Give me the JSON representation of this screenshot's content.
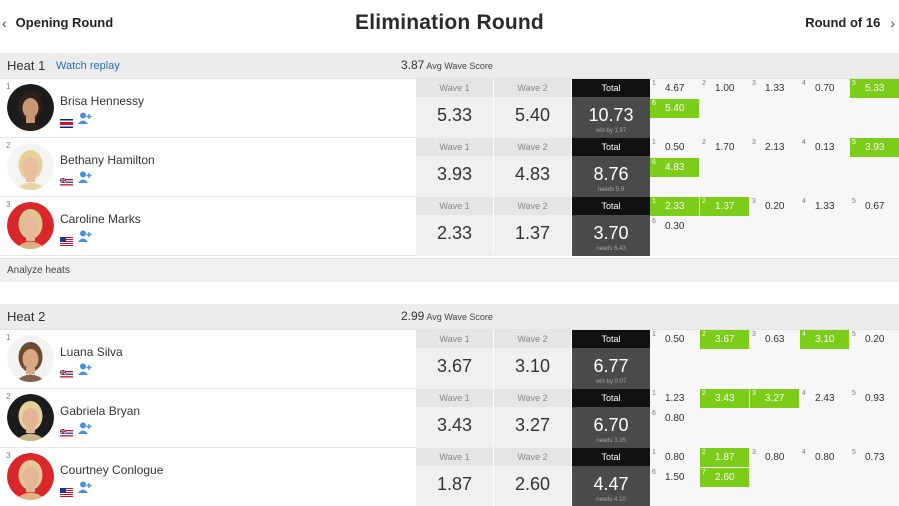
{
  "nav": {
    "prev_label": "Opening Round",
    "next_label": "Round of 16",
    "title": "Elimination Round"
  },
  "labels": {
    "wave1": "Wave 1",
    "wave2": "Wave 2",
    "total": "Total",
    "avg_label": "Avg Wave Score",
    "watch_replay": "Watch replay",
    "analyze": "Analyze heats"
  },
  "colors": {
    "highlight": "#7ccc1a",
    "total_bg": "#4a4a4a",
    "total_header": "#111111",
    "link": "#2a6fb0"
  },
  "heats": [
    {
      "title": "Heat 1",
      "avg": "3.87",
      "surfers": [
        {
          "seed": "1",
          "name": "Brisa Hennessy",
          "flag": "costa-rica-flag",
          "avatar_bg": "#1b1b1b",
          "hair": "#2e211a",
          "skin": "#c99772",
          "ring": "#111111",
          "wave1": "5.33",
          "wave2": "5.40",
          "total": "10.73",
          "note": "win by 1.97",
          "waves": [
            {
              "n": "1",
              "s": "4.67",
              "hl": false
            },
            {
              "n": "2",
              "s": "1.00",
              "hl": false
            },
            {
              "n": "3",
              "s": "1.33",
              "hl": false
            },
            {
              "n": "4",
              "s": "0.70",
              "hl": false
            },
            {
              "n": "5",
              "s": "5.33",
              "hl": true
            },
            {
              "n": "6",
              "s": "5.40",
              "hl": true
            }
          ]
        },
        {
          "seed": "2",
          "name": "Bethany Hamilton",
          "flag": "hawaii-flag",
          "avatar_bg": "#f4f4f4",
          "hair": "#e6cf98",
          "skin": "#e8bda0",
          "ring": "#ffffff",
          "wave1": "3.93",
          "wave2": "4.83",
          "total": "8.76",
          "note": "needs 5.9",
          "waves": [
            {
              "n": "1",
              "s": "0.50",
              "hl": false
            },
            {
              "n": "2",
              "s": "1.70",
              "hl": false
            },
            {
              "n": "3",
              "s": "2.13",
              "hl": false
            },
            {
              "n": "4",
              "s": "0.13",
              "hl": false
            },
            {
              "n": "5",
              "s": "3.93",
              "hl": true
            },
            {
              "n": "6",
              "s": "4.83",
              "hl": true
            }
          ]
        },
        {
          "seed": "3",
          "name": "Caroline Marks",
          "flag": "usa-flag",
          "avatar_bg": "#d8282c",
          "hair": "#e0c48e",
          "skin": "#e7b99b",
          "ring": "#d8282c",
          "wave1": "2.33",
          "wave2": "1.37",
          "total": "3.70",
          "note": "needs 6.43",
          "waves": [
            {
              "n": "1",
              "s": "2.33",
              "hl": true
            },
            {
              "n": "2",
              "s": "1.37",
              "hl": true
            },
            {
              "n": "3",
              "s": "0.20",
              "hl": false
            },
            {
              "n": "4",
              "s": "1.33",
              "hl": false
            },
            {
              "n": "5",
              "s": "0.67",
              "hl": false
            },
            {
              "n": "6",
              "s": "0.30",
              "hl": false
            }
          ]
        }
      ]
    },
    {
      "title": "Heat 2",
      "avg": "2.99",
      "surfers": [
        {
          "seed": "1",
          "name": "Luana Silva",
          "flag": "hawaii-flag",
          "avatar_bg": "#f2f2f2",
          "hair": "#6b4a30",
          "skin": "#d7a884",
          "ring": "#ffffff",
          "wave1": "3.67",
          "wave2": "3.10",
          "total": "6.77",
          "note": "win by 0.07",
          "waves": [
            {
              "n": "1",
              "s": "0.50",
              "hl": false
            },
            {
              "n": "2",
              "s": "3.67",
              "hl": true
            },
            {
              "n": "3",
              "s": "0.63",
              "hl": false
            },
            {
              "n": "4",
              "s": "3.10",
              "hl": true
            },
            {
              "n": "5",
              "s": "0.20",
              "hl": false
            }
          ]
        },
        {
          "seed": "2",
          "name": "Gabriela Bryan",
          "flag": "hawaii-flag",
          "avatar_bg": "#1b1b1b",
          "hair": "#e6cf98",
          "skin": "#e2b394",
          "ring": "#111111",
          "wave1": "3.43",
          "wave2": "3.27",
          "total": "6.70",
          "note": "needs 3.35",
          "waves": [
            {
              "n": "1",
              "s": "1.23",
              "hl": false
            },
            {
              "n": "2",
              "s": "3.43",
              "hl": true
            },
            {
              "n": "3",
              "s": "3.27",
              "hl": true
            },
            {
              "n": "4",
              "s": "2.43",
              "hl": false
            },
            {
              "n": "5",
              "s": "0.93",
              "hl": false
            },
            {
              "n": "6",
              "s": "0.80",
              "hl": false
            }
          ]
        },
        {
          "seed": "3",
          "name": "Courtney Conlogue",
          "flag": "usa-flag",
          "avatar_bg": "#d8282c",
          "hair": "#e3c890",
          "skin": "#e4b597",
          "ring": "#d8282c",
          "wave1": "1.87",
          "wave2": "2.60",
          "total": "4.47",
          "note": "needs 4.10",
          "waves": [
            {
              "n": "1",
              "s": "0.80",
              "hl": false
            },
            {
              "n": "2",
              "s": "1.87",
              "hl": true
            },
            {
              "n": "3",
              "s": "0.80",
              "hl": false
            },
            {
              "n": "4",
              "s": "0.80",
              "hl": false
            },
            {
              "n": "5",
              "s": "0.73",
              "hl": false
            },
            {
              "n": "6",
              "s": "1.50",
              "hl": false
            },
            {
              "n": "7",
              "s": "2.60",
              "hl": true
            }
          ]
        }
      ]
    }
  ]
}
